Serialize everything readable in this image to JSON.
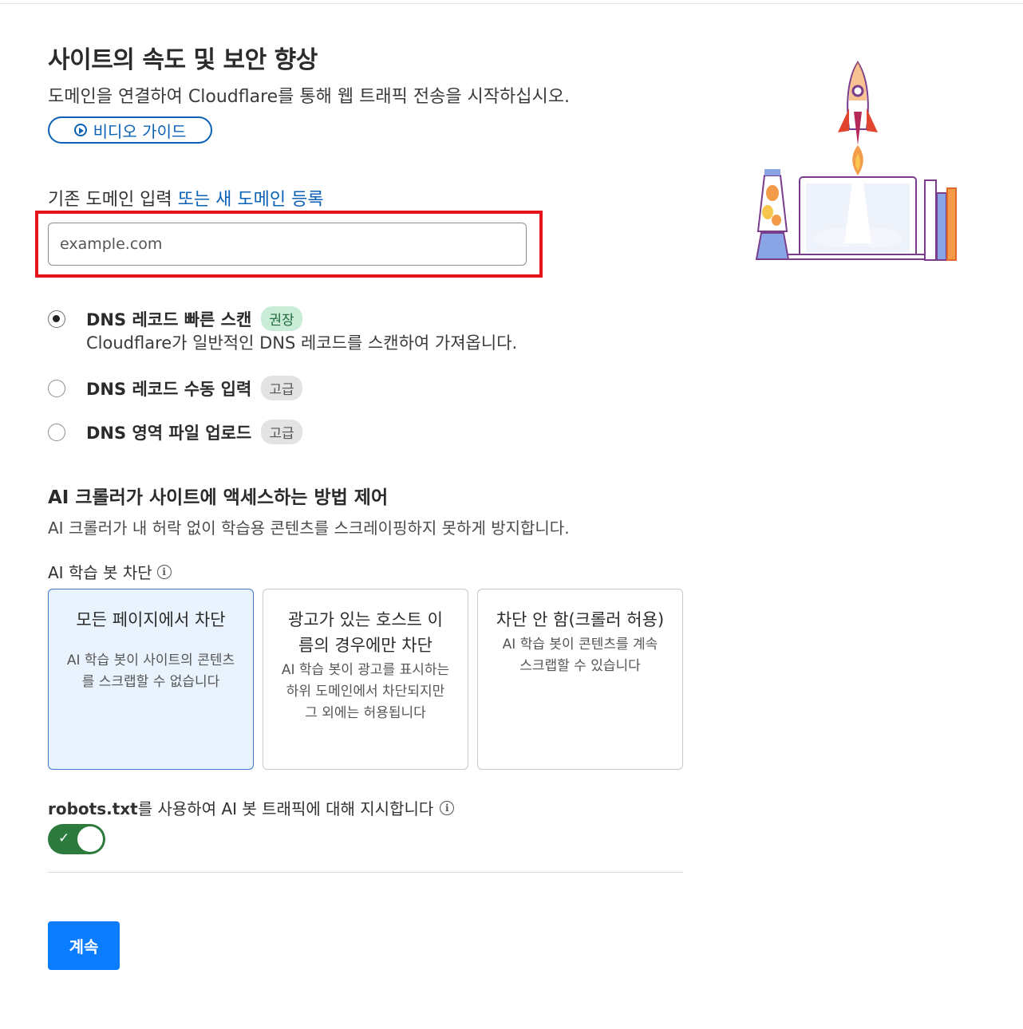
{
  "header": {
    "title": "사이트의 속도 및 보안 향상",
    "subtitle": "도메인을 연결하여 Cloudflare를 통해 웹 트래픽 전송을 시작하십시오.",
    "video_button_label": "비디오 가이드"
  },
  "domain": {
    "label": "기존 도메인 입력",
    "link_label": "또는 새 도메인 등록",
    "input_placeholder": "example.com",
    "input_value": ""
  },
  "dns_options": [
    {
      "label": "DNS 레코드 빠른 스캔",
      "badge": "권장",
      "checked": true,
      "description": "Cloudflare가 일반적인 DNS 레코드를 스캔하여 가져옵니다."
    },
    {
      "label": "DNS 레코드 수동 입력",
      "badge": "고급",
      "checked": false
    },
    {
      "label": "DNS 영역 파일 업로드",
      "badge": "고급",
      "checked": false
    }
  ],
  "ai_section": {
    "title": "AI 크롤러가 사이트에 액세스하는 방법 제어",
    "description": "AI 크롤러가 내 허락 없이 학습용 콘텐츠를 스크레이핑하지 못하게 방지합니다.",
    "block_label": "AI 학습 봇 차단",
    "cards": [
      {
        "title": "모든 페이지에서 차단",
        "description": "AI 학습 봇이 사이트의 콘텐츠를 스크랩할 수 없습니다",
        "selected": true
      },
      {
        "title": "광고가 있는 호스트 이름의 경우에만 차단",
        "description": "AI 학습 봇이 광고를 표시하는 하위 도메인에서 차단되지만 그 외에는 허용됩니다",
        "selected": false
      },
      {
        "title": "차단 안 함(크롤러 허용)",
        "description": "AI 학습 봇이 콘텐츠를 계속 스크랩할 수 있습니다",
        "selected": false
      }
    ],
    "robots_prefix": "robots.txt",
    "robots_label": "를 사용하여 AI 봇 트래픽에 대해 지시합니다",
    "robots_toggle_on": true,
    "toggle_color": "#2c7a3c"
  },
  "footer": {
    "continue_label": "계속",
    "continue_color": "#0a7cff"
  },
  "icons": {
    "play": "play-circle-icon",
    "info": "info-icon",
    "check": "check-icon",
    "illustration": "rocket-laptop-illustration"
  },
  "colors": {
    "accent": "#0b61b6",
    "highlight": "#e5141b",
    "selected_card_bg": "#e9f3fd"
  }
}
